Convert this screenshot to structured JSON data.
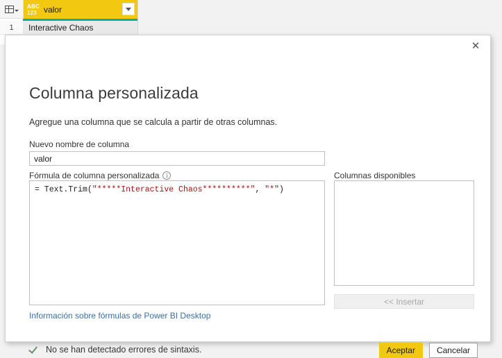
{
  "grid": {
    "corner_icon": "table-icon",
    "column": {
      "type_icon_top": "ABC",
      "type_icon_bottom": "123",
      "name": "valor",
      "dropdown_icon": "chevron-down-icon"
    },
    "rows": [
      {
        "number": "1",
        "value": "Interactive Chaos"
      }
    ]
  },
  "dialog": {
    "close_icon": "✕",
    "title": "Columna personalizada",
    "subtitle": "Agregue una columna que se calcula a partir de otras columnas.",
    "new_column_name": {
      "label": "Nuevo nombre de columna",
      "value": "valor",
      "placeholder": ""
    },
    "formula": {
      "label": "Fórmula de columna personalizada",
      "info_icon": "i",
      "prefix": "= Text.Trim(",
      "arg1": "\"*****Interactive Chaos**********\"",
      "separator": ", ",
      "arg2": "\"*\"",
      "suffix": ")"
    },
    "help_link": "Información sobre fórmulas de Power BI Desktop",
    "available_columns": {
      "label": "Columnas disponibles",
      "items": [],
      "insert_button": "<< Insertar"
    },
    "status": {
      "icon": "check-icon",
      "text": "No se han detectado errores de sintaxis."
    },
    "buttons": {
      "accept": "Aceptar",
      "cancel": "Cancelar"
    }
  },
  "colors": {
    "accent_yellow": "#f2c811",
    "selection_teal": "#00b0a0",
    "link_blue": "#3a6ea5",
    "string_literal": "#a31515",
    "status_green": "#6a8f72"
  }
}
